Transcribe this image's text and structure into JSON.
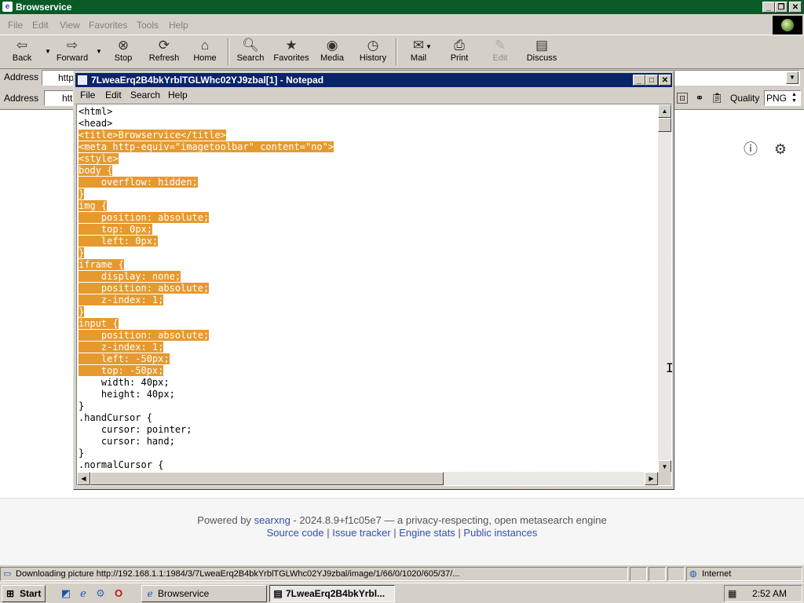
{
  "browser": {
    "title": "Browservice",
    "menu": [
      "File",
      "Edit",
      "View",
      "Favorites",
      "Tools",
      "Help"
    ],
    "toolbar": {
      "back": "Back",
      "forward": "Forward",
      "stop": "Stop",
      "refresh": "Refresh",
      "home": "Home",
      "search": "Search",
      "favorites": "Favorites",
      "media": "Media",
      "history": "History",
      "mail": "Mail",
      "print": "Print",
      "edit": "Edit",
      "discuss": "Discuss"
    },
    "address_label": "Address",
    "address_value": "http",
    "address2_label": "Address",
    "address2_value": "htt",
    "quality_label": "Quality",
    "quality_value": "PNG"
  },
  "notepad": {
    "title": "7LweaErq2B4bkYrblTGLWhc02YJ9zbal[1] - Notepad",
    "menu": [
      "File",
      "Edit",
      "Search",
      "Help"
    ],
    "lines": [
      {
        "t": "<html>",
        "hl": false
      },
      {
        "t": "<head>",
        "hl": false
      },
      {
        "t": "<title>Browservice</title>",
        "hl": true
      },
      {
        "t": "<meta http-equiv=\"imagetoolbar\" content=\"no\">",
        "hl": true
      },
      {
        "t": "<style>",
        "hl": true
      },
      {
        "t": "body {",
        "hl": true
      },
      {
        "t": "    overflow: hidden;",
        "hl": true
      },
      {
        "t": "}",
        "hl": true
      },
      {
        "t": "img {",
        "hl": true
      },
      {
        "t": "    position: absolute;",
        "hl": true
      },
      {
        "t": "    top: 0px;",
        "hl": true
      },
      {
        "t": "    left: 0px;",
        "hl": true
      },
      {
        "t": "}",
        "hl": true
      },
      {
        "t": "iframe {",
        "hl": true
      },
      {
        "t": "    display: none;",
        "hl": true
      },
      {
        "t": "    position: absolute;",
        "hl": true
      },
      {
        "t": "    z-index: 1;",
        "hl": true
      },
      {
        "t": "}",
        "hl": true
      },
      {
        "t": "input {",
        "hl": true
      },
      {
        "t": "    position: absolute;",
        "hl": true
      },
      {
        "t": "    z-index: 1;",
        "hl": true
      },
      {
        "t": "    left: -50px;",
        "hl": true
      },
      {
        "t": "    top: -50px;",
        "hl": true
      },
      {
        "t": "    width: 40px;",
        "hl": false
      },
      {
        "t": "    height: 40px;",
        "hl": false
      },
      {
        "t": "}",
        "hl": false
      },
      {
        "t": ".handCursor {",
        "hl": false
      },
      {
        "t": "    cursor: pointer;",
        "hl": false
      },
      {
        "t": "    cursor: hand;",
        "hl": false
      },
      {
        "t": "}",
        "hl": false
      },
      {
        "t": ".normalCursor {",
        "hl": false
      }
    ]
  },
  "page": {
    "footer_prefix": "Powered by",
    "footer_brand": "searxng",
    "footer_suffix": " - 2024.8.9+f1c05e7 — a privacy-respecting, open metasearch engine",
    "links": [
      "Source code",
      "Issue tracker",
      "Engine stats",
      "Public instances"
    ]
  },
  "status": {
    "text": "Downloading picture http://192.168.1.1:1984/3/7LweaErq2B4bkYrblTGLWhc02YJ9zbal/image/1/66/0/1020/605/37/...",
    "zone": "Internet"
  },
  "taskbar": {
    "start": "Start",
    "tasks": [
      "Browservice",
      "7LweaErq2B4bkYrbl..."
    ],
    "clock": "2:52 AM"
  }
}
